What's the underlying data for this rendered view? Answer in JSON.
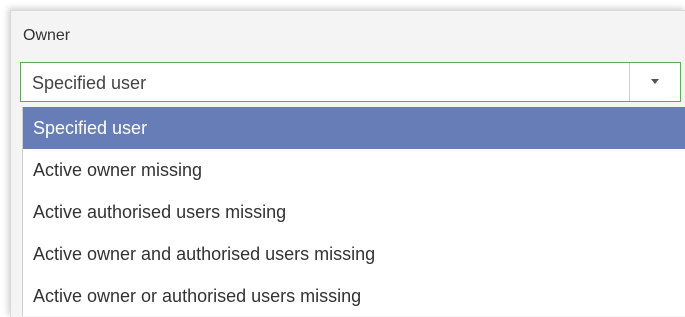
{
  "owner_field": {
    "label": "Owner",
    "selected_value": "Specified user",
    "toggle_icon": "chevron-down-icon",
    "accent_border": "#62a65a"
  },
  "dropdown": {
    "highlight_color": "#677db7",
    "options": [
      {
        "label": "Specified user",
        "selected": true
      },
      {
        "label": "Active owner missing",
        "selected": false
      },
      {
        "label": "Active authorised users missing",
        "selected": false
      },
      {
        "label": "Active owner and authorised users missing",
        "selected": false
      },
      {
        "label": "Active owner or authorised users missing",
        "selected": false
      }
    ]
  }
}
